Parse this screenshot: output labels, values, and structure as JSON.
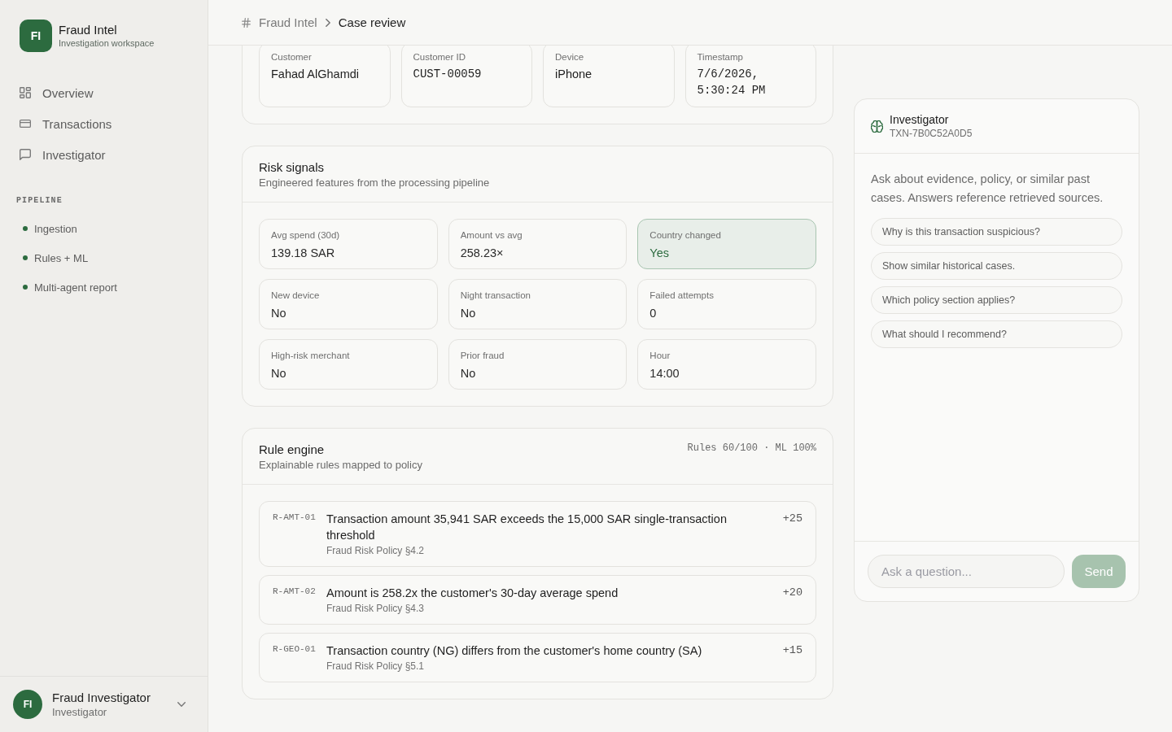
{
  "sidebar": {
    "brand": {
      "initials": "FI",
      "title": "Fraud Intel",
      "subtitle": "Investigation workspace"
    },
    "nav": [
      {
        "label": "Overview",
        "selected": false
      },
      {
        "label": "Transactions",
        "selected": false
      },
      {
        "label": "Investigator",
        "selected": false
      }
    ],
    "pipeline": {
      "title": "PIPELINE",
      "items": [
        {
          "label": "Ingestion",
          "color": "#2c6b3f"
        },
        {
          "label": "Rules + ML",
          "color": "#2c6b3f"
        },
        {
          "label": "Multi-agent report",
          "color": "#2c6b3f"
        }
      ]
    },
    "user": {
      "initials": "FI",
      "name": "Fraud Investigator",
      "role": "Investigator"
    }
  },
  "breadcrumb": [
    {
      "label": "Fraud Intel",
      "current": false
    },
    {
      "label": "Case review",
      "current": true
    }
  ],
  "transaction_details": {
    "fields": [
      {
        "label": "Customer",
        "value": "Fahad AlGhamdi",
        "kind": "text"
      },
      {
        "label": "Customer ID",
        "value": "CUST-00059",
        "kind": "mono"
      },
      {
        "label": "Device",
        "value": "iPhone",
        "kind": "text"
      },
      {
        "label": "Timestamp",
        "value": "7/6/2026, 5:30:24 PM",
        "kind": "mono"
      }
    ]
  },
  "risk_signals": {
    "title": "Risk signals",
    "subtitle": "Engineered features from the processing pipeline",
    "signals": [
      {
        "label": "Avg spend (30d)",
        "value": "139.18 SAR",
        "flagged": false
      },
      {
        "label": "Amount vs avg",
        "value": "258.23×",
        "flagged": false
      },
      {
        "label": "Country changed",
        "value": "Yes",
        "flagged": true
      },
      {
        "label": "New device",
        "value": "No",
        "flagged": false
      },
      {
        "label": "Night transaction",
        "value": "No",
        "flagged": false
      },
      {
        "label": "Failed attempts",
        "value": "0",
        "flagged": false
      },
      {
        "label": "High-risk merchant",
        "value": "No",
        "flagged": false
      },
      {
        "label": "Prior fraud",
        "value": "No",
        "flagged": false
      },
      {
        "label": "Hour",
        "value": "14:00",
        "flagged": false
      }
    ]
  },
  "rule_engine": {
    "title": "Rule engine",
    "subtitle": "Explainable rules mapped to policy",
    "summary": "Rules 60/100 · ML 100%",
    "rules": [
      {
        "code": "R-AMT-01",
        "description": "Transaction amount 35,941 SAR exceeds the 15,000 SAR single-transaction threshold",
        "policy": "Fraud Risk Policy §4.2",
        "score": "+25"
      },
      {
        "code": "R-AMT-02",
        "description": "Amount is 258.2x the customer's 30-day average spend",
        "policy": "Fraud Risk Policy §4.3",
        "score": "+20"
      },
      {
        "code": "R-GEO-01",
        "description": "Transaction country (NG) differs from the customer's home country (SA)",
        "policy": "Fraud Risk Policy §5.1",
        "score": "+15"
      }
    ]
  },
  "investigator": {
    "title": "Investigator",
    "transaction_id": "TXN-7B0C52A0D5",
    "intro": "Ask about evidence, policy, or similar past cases. Answers reference retrieved sources.",
    "suggestions": [
      "Why is this transaction suspicious?",
      "Show similar historical cases.",
      "Which policy section applies?",
      "What should I recommend?"
    ],
    "input": {
      "placeholder": "Ask a question..."
    },
    "send_button": {
      "label": "Send",
      "disabled": true
    }
  }
}
